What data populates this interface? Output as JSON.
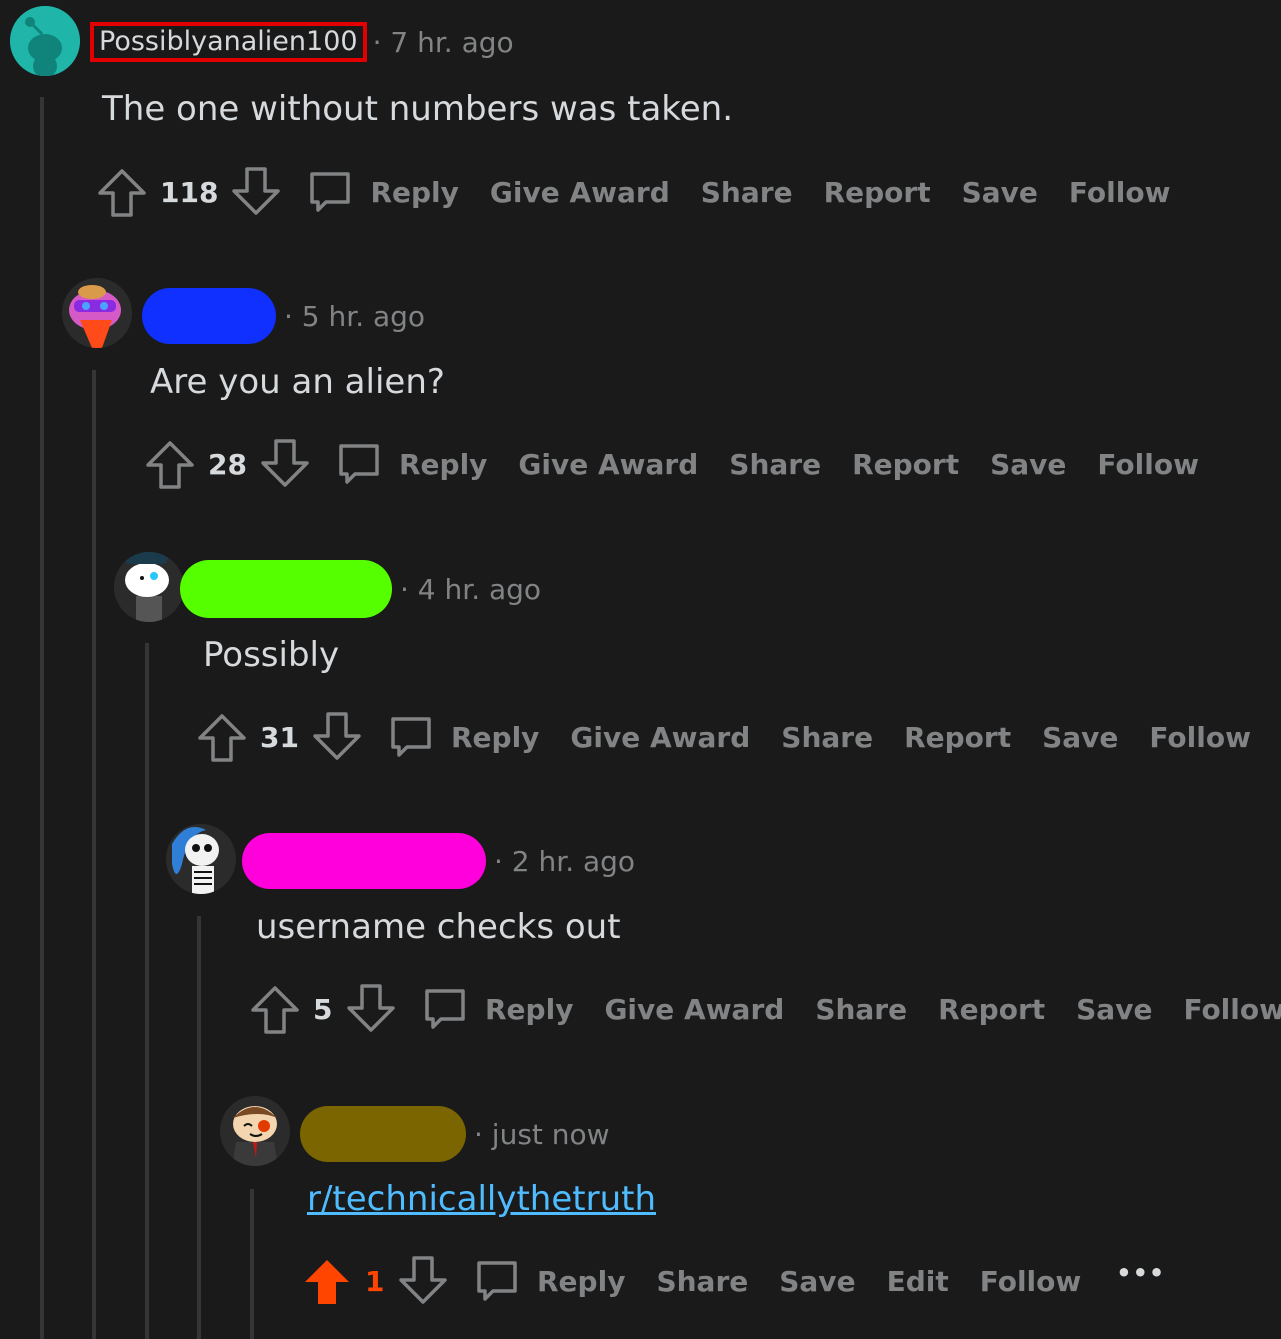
{
  "comments": [
    {
      "username": "Possiblyanalien100",
      "time": "· 7 hr. ago",
      "body": "The one without numbers was taken.",
      "votes": "118",
      "actions": [
        "Reply",
        "Give Award",
        "Share",
        "Report",
        "Save",
        "Follow"
      ]
    },
    {
      "time": "· 5 hr. ago",
      "body": "Are you an alien?",
      "votes": "28",
      "actions": [
        "Reply",
        "Give Award",
        "Share",
        "Report",
        "Save",
        "Follow"
      ],
      "redaction_color": "#1030ff"
    },
    {
      "time": "· 4 hr. ago",
      "body": "Possibly",
      "votes": "31",
      "actions": [
        "Reply",
        "Give Award",
        "Share",
        "Report",
        "Save",
        "Follow"
      ],
      "redaction_color": "#55ff00"
    },
    {
      "time": "· 2 hr. ago",
      "body": "username checks out",
      "votes": "5",
      "actions": [
        "Reply",
        "Give Award",
        "Share",
        "Report",
        "Save",
        "Follow"
      ],
      "redaction_color": "#ff00dd"
    },
    {
      "time": "· just now",
      "body": "r/technicallythetruth",
      "votes": "1",
      "actions": [
        "Reply",
        "Share",
        "Save",
        "Edit",
        "Follow"
      ],
      "more": "•••",
      "upvoted": true,
      "redaction_color": "#7a6500"
    }
  ],
  "colors": {
    "background": "#1a1a1b",
    "text": "#d7dadc",
    "muted": "#818384",
    "upvote": "#ff4500",
    "link": "#4fbcff",
    "highlight_box": "#e30000"
  },
  "icons": [
    "upvote-arrow-icon",
    "downvote-arrow-icon",
    "comment-bubble-icon",
    "more-icon"
  ]
}
